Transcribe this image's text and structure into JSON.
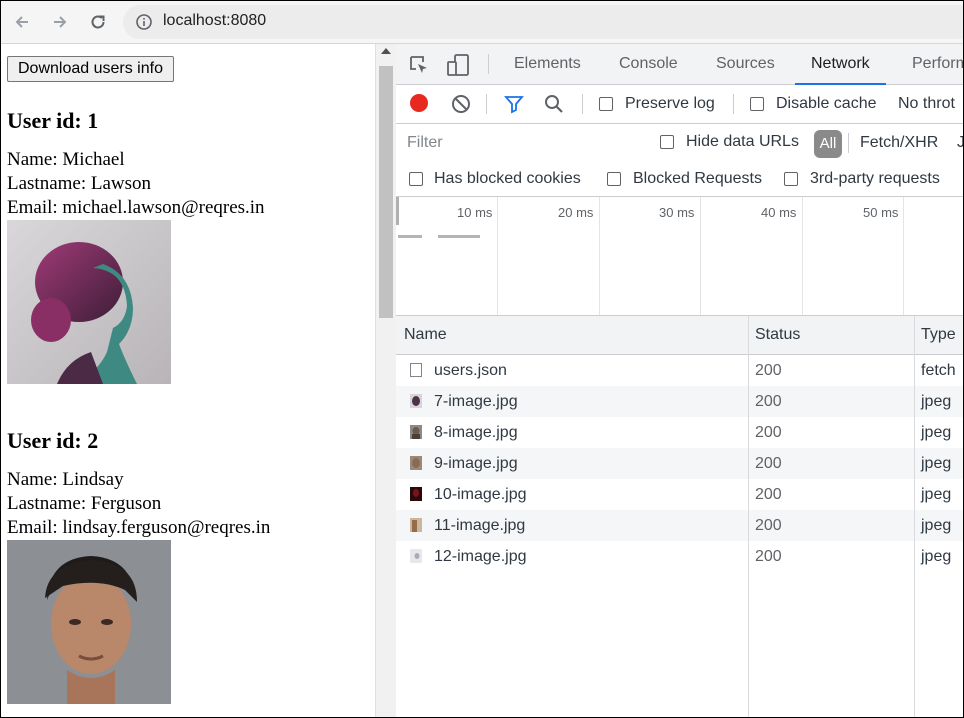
{
  "browser": {
    "url": "localhost:8080"
  },
  "page": {
    "download_button": "Download users info",
    "users": [
      {
        "heading": "User id: 1",
        "name_line": "Name: Michael",
        "lastname_line": "Lastname: Lawson",
        "email_line": "Email: michael.lawson@reqres.in"
      },
      {
        "heading": "User id: 2",
        "name_line": "Name: Lindsay",
        "lastname_line": "Lastname: Ferguson",
        "email_line": "Email: lindsay.ferguson@reqres.in"
      }
    ]
  },
  "devtools": {
    "tabs": [
      "Elements",
      "Console",
      "Sources",
      "Network",
      "Perform"
    ],
    "active_tab": "Network",
    "toolbar": {
      "preserve_log": "Preserve log",
      "disable_cache": "Disable cache",
      "throttling": "No throt"
    },
    "filter": {
      "placeholder": "Filter",
      "hide_data_urls": "Hide data URLs",
      "all": "All",
      "fetch_xhr": "Fetch/XHR",
      "js_cut": "J"
    },
    "blocked": {
      "has_blocked_cookies": "Has blocked cookies",
      "blocked_requests": "Blocked Requests",
      "third_party": "3rd-party requests"
    },
    "timeline_ticks": [
      "10 ms",
      "20 ms",
      "30 ms",
      "40 ms",
      "50 ms"
    ],
    "columns": {
      "name": "Name",
      "status": "Status",
      "type": "Type"
    },
    "requests": [
      {
        "name": "users.json",
        "status": "200",
        "type": "fetch",
        "icon": "document-icon"
      },
      {
        "name": "7-image.jpg",
        "status": "200",
        "type": "jpeg",
        "icon": "image-thumb-icon",
        "thumb_color": "#4a3348"
      },
      {
        "name": "8-image.jpg",
        "status": "200",
        "type": "jpeg",
        "icon": "image-thumb-icon",
        "thumb_color": "#6b5a4a"
      },
      {
        "name": "9-image.jpg",
        "status": "200",
        "type": "jpeg",
        "icon": "image-thumb-icon",
        "thumb_color": "#8a6a55"
      },
      {
        "name": "10-image.jpg",
        "status": "200",
        "type": "jpeg",
        "icon": "image-thumb-icon",
        "thumb_color": "#7a1418"
      },
      {
        "name": "11-image.jpg",
        "status": "200",
        "type": "jpeg",
        "icon": "image-thumb-icon",
        "thumb_color": "#9a6b48"
      },
      {
        "name": "12-image.jpg",
        "status": "200",
        "type": "jpeg",
        "icon": "image-thumb-icon",
        "thumb_color": "#c9ccd2"
      }
    ],
    "colors": {
      "record": "#e8291f",
      "filter_icon": "#1a73e8",
      "active_tab_underline": "#1a73e8"
    }
  }
}
